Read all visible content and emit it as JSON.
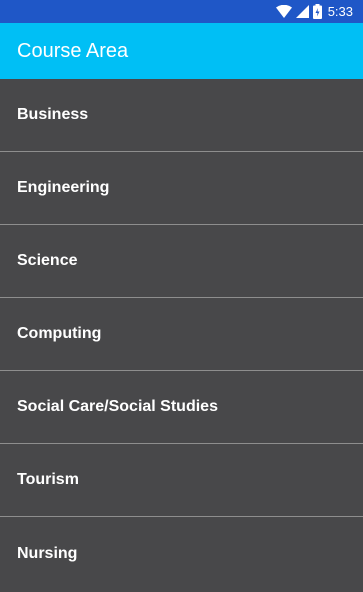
{
  "status_bar": {
    "time": "5:33",
    "icons": [
      "wifi-icon",
      "signal-icon",
      "battery-icon"
    ],
    "color": "#1f57c7"
  },
  "app_bar": {
    "title": "Course Area",
    "color": "#00bff5"
  },
  "list": {
    "background": "#48484a",
    "items": [
      {
        "label": "Business"
      },
      {
        "label": "Engineering"
      },
      {
        "label": "Science"
      },
      {
        "label": "Computing"
      },
      {
        "label": "Social Care/Social Studies"
      },
      {
        "label": "Tourism"
      },
      {
        "label": "Nursing"
      }
    ]
  }
}
